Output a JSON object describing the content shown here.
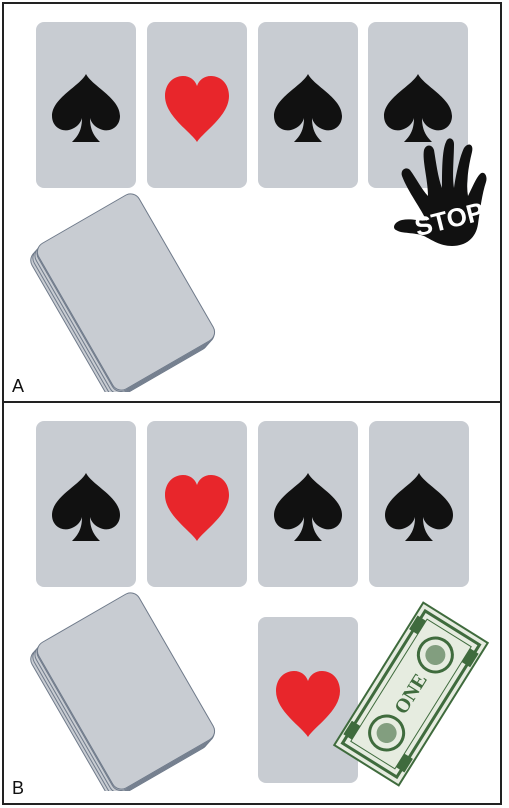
{
  "panels": [
    {
      "label": "A",
      "card_row": [
        "spade",
        "heart",
        "spade",
        "spade"
      ],
      "revealed_card": null,
      "stop_hand_text": "STOP",
      "show_bill": false
    },
    {
      "label": "B",
      "card_row": [
        "spade",
        "heart",
        "spade",
        "spade"
      ],
      "revealed_card": "heart",
      "stop_hand_text": null,
      "show_bill": true,
      "bill_text": "ONE"
    }
  ],
  "colors": {
    "card_face": "#c8ccd2",
    "spade": "#111111",
    "heart": "#e8262b",
    "bill_green": "#3f6b3d",
    "bill_light": "#e6ece0",
    "stop_hand": "#111111"
  }
}
